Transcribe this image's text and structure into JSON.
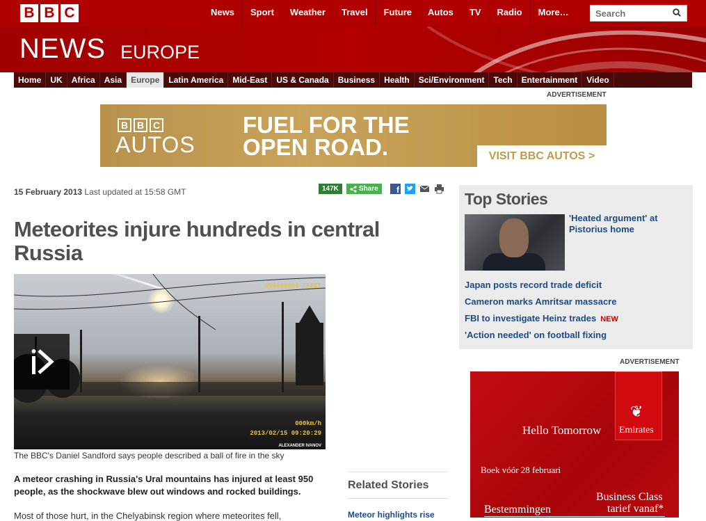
{
  "topbar": {
    "logo_letters": [
      "B",
      "B",
      "C"
    ],
    "nav": [
      "News",
      "Sport",
      "Weather",
      "Travel",
      "Future",
      "Autos",
      "TV",
      "Radio",
      "More…"
    ],
    "search_placeholder": "Search"
  },
  "masthead": {
    "title": "NEWS",
    "region": "EUROPE"
  },
  "subnav": {
    "items": [
      "Home",
      "UK",
      "Africa",
      "Asia",
      "Europe",
      "Latin America",
      "Mid-East",
      "US & Canada",
      "Business",
      "Health",
      "Sci/Environment",
      "Tech",
      "Entertainment",
      "Video"
    ],
    "active": "Europe"
  },
  "ads": {
    "label_top": "ADVERTISEMENT",
    "label_side": "ADVERTISEMENT",
    "banner": {
      "logo_letters": [
        "B",
        "B",
        "C"
      ],
      "logo_word": "AUTOS",
      "headline_line1": "FUEL FOR THE",
      "headline_line2": "OPEN ROAD.",
      "cta": "VISIT BBC AUTOS >"
    },
    "emirates": {
      "tagline": "Hello Tomorrow",
      "brand": "Emirates",
      "boek": "Boek vóór 28 februari",
      "bestemmingen": "Bestemmingen",
      "business_line1": "Business Class",
      "business_line2": "tarief vanaf*"
    }
  },
  "article": {
    "date": "15 February 2013",
    "updated": "Last updated at 15:58 GMT",
    "share_count": "147K",
    "share_label": "Share",
    "headline": "Meteorites injure hundreds in central Russia",
    "video_overlay_top": "000000000 TEXET",
    "video_overlay_speed": "000km/h",
    "video_overlay_time": "2013/02/15 09:20:29",
    "video_credit": "ALEXANDER IVANOV",
    "caption": "The BBC's Daniel Sandford says people described a ball of fire in the sky",
    "intro": "A meteor crashing in Russia's Ural mountains has injured at least 950 people, as the shockwave blew out windows and rocked buildings.",
    "body": "Most of those hurt, in the Chelyabinsk region where meteorites fell,"
  },
  "related": {
    "title": "Related Stories",
    "items": [
      "Meteor highlights rise"
    ]
  },
  "top_stories": {
    "title": "Top Stories",
    "lead": "'Heated argument' at Pistorius home",
    "items": [
      {
        "text": "Japan posts record trade deficit",
        "badge": ""
      },
      {
        "text": "Cameron marks Amritsar massacre",
        "badge": ""
      },
      {
        "text": "FBI to investigate Heinz trades",
        "badge": "NEW"
      },
      {
        "text": "'Action needed' on football fixing",
        "badge": ""
      }
    ]
  }
}
